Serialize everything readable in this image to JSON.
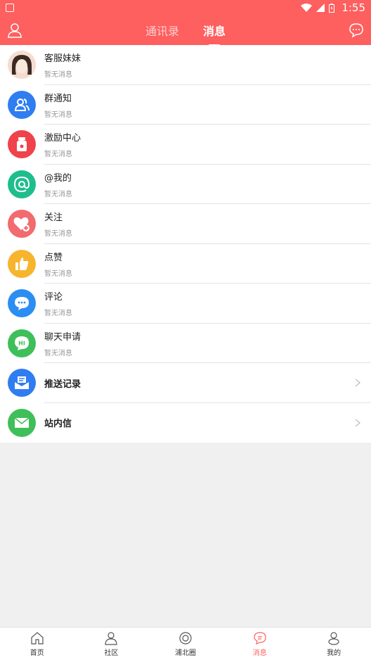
{
  "statusbar": {
    "time": "1:55"
  },
  "header": {
    "tabs": [
      {
        "label": "通讯录",
        "active": false
      },
      {
        "label": "消息",
        "active": true
      }
    ]
  },
  "messages": [
    {
      "title": "客服妹妹",
      "sub": "暂无消息",
      "icon": "customer-service-avatar",
      "color": "#f2d7c9"
    },
    {
      "title": "群通知",
      "sub": "暂无消息",
      "icon": "group-icon",
      "color": "#2f7df0"
    },
    {
      "title": "激励中心",
      "sub": "暂无消息",
      "icon": "reward-bag-icon",
      "color": "#f0424a"
    },
    {
      "title": "@我的",
      "sub": "暂无消息",
      "icon": "at-icon",
      "color": "#1dbe8c"
    },
    {
      "title": "关注",
      "sub": "暂无消息",
      "icon": "heart-plus-icon",
      "color": "#f36a6f"
    },
    {
      "title": "点赞",
      "sub": "暂无消息",
      "icon": "thumb-up-icon",
      "color": "#f7b52e"
    },
    {
      "title": "评论",
      "sub": "暂无消息",
      "icon": "comment-icon",
      "color": "#2b8ef2"
    },
    {
      "title": "聊天申请",
      "sub": "暂无消息",
      "icon": "chat-hi-icon",
      "color": "#3fbf5a"
    }
  ],
  "links": [
    {
      "title": "推送记录",
      "icon": "push-record-icon",
      "color": "#2f7df0"
    },
    {
      "title": "站内信",
      "icon": "mail-icon",
      "color": "#3fbf5a"
    }
  ],
  "bottom_nav": [
    {
      "label": "首页",
      "icon": "home-icon",
      "active": false
    },
    {
      "label": "社区",
      "icon": "community-icon",
      "active": false
    },
    {
      "label": "浦北圈",
      "icon": "circle-icon",
      "active": false
    },
    {
      "label": "消息",
      "icon": "message-icon",
      "active": true
    },
    {
      "label": "我的",
      "icon": "profile-icon",
      "active": false
    }
  ],
  "colors": {
    "accent": "#fe5f5f"
  }
}
